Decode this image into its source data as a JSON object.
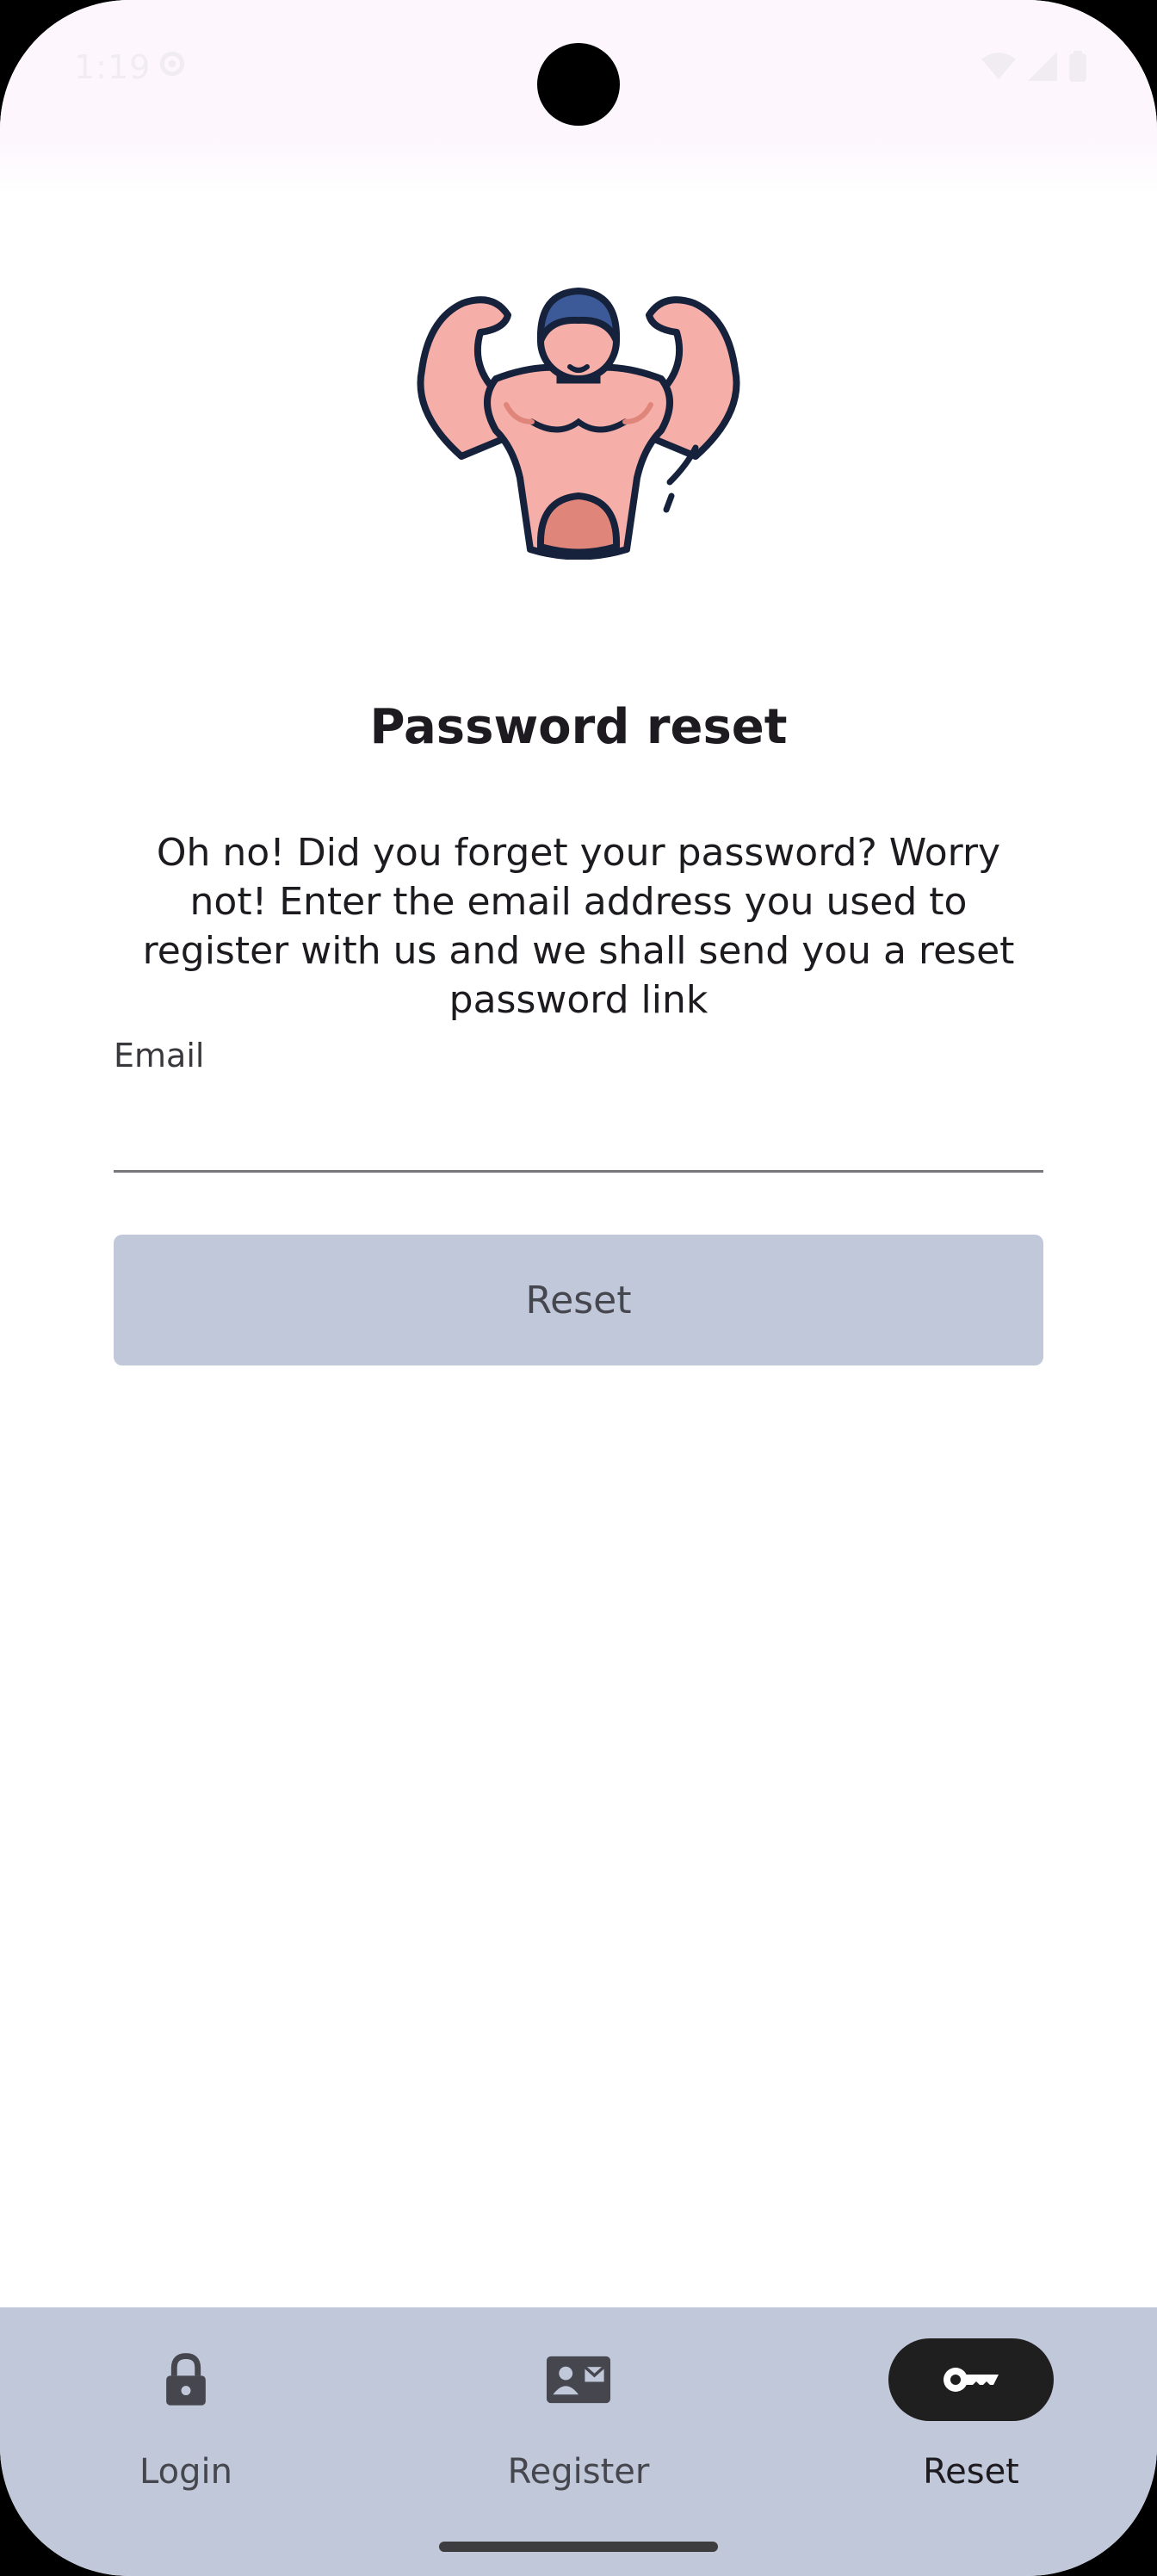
{
  "status_bar": {
    "time": "1:19"
  },
  "page": {
    "title": "Password reset",
    "description": "Oh no! Did you forget your password? Worry not! Enter the email address you used to register with us and we shall send you a reset password link"
  },
  "form": {
    "email_label": "Email",
    "email_value": "",
    "reset_button": "Reset"
  },
  "bottom_nav": {
    "items": [
      {
        "label": "Login",
        "icon": "lock-icon",
        "active": false
      },
      {
        "label": "Register",
        "icon": "contact-card-icon",
        "active": false
      },
      {
        "label": "Reset",
        "icon": "key-icon",
        "active": true
      }
    ]
  },
  "colors": {
    "nav_background": "#c0c8d9",
    "button_background": "#c0c8d9",
    "active_indicator": "#1f1f1f",
    "status_bar": "#fdf7fd"
  }
}
